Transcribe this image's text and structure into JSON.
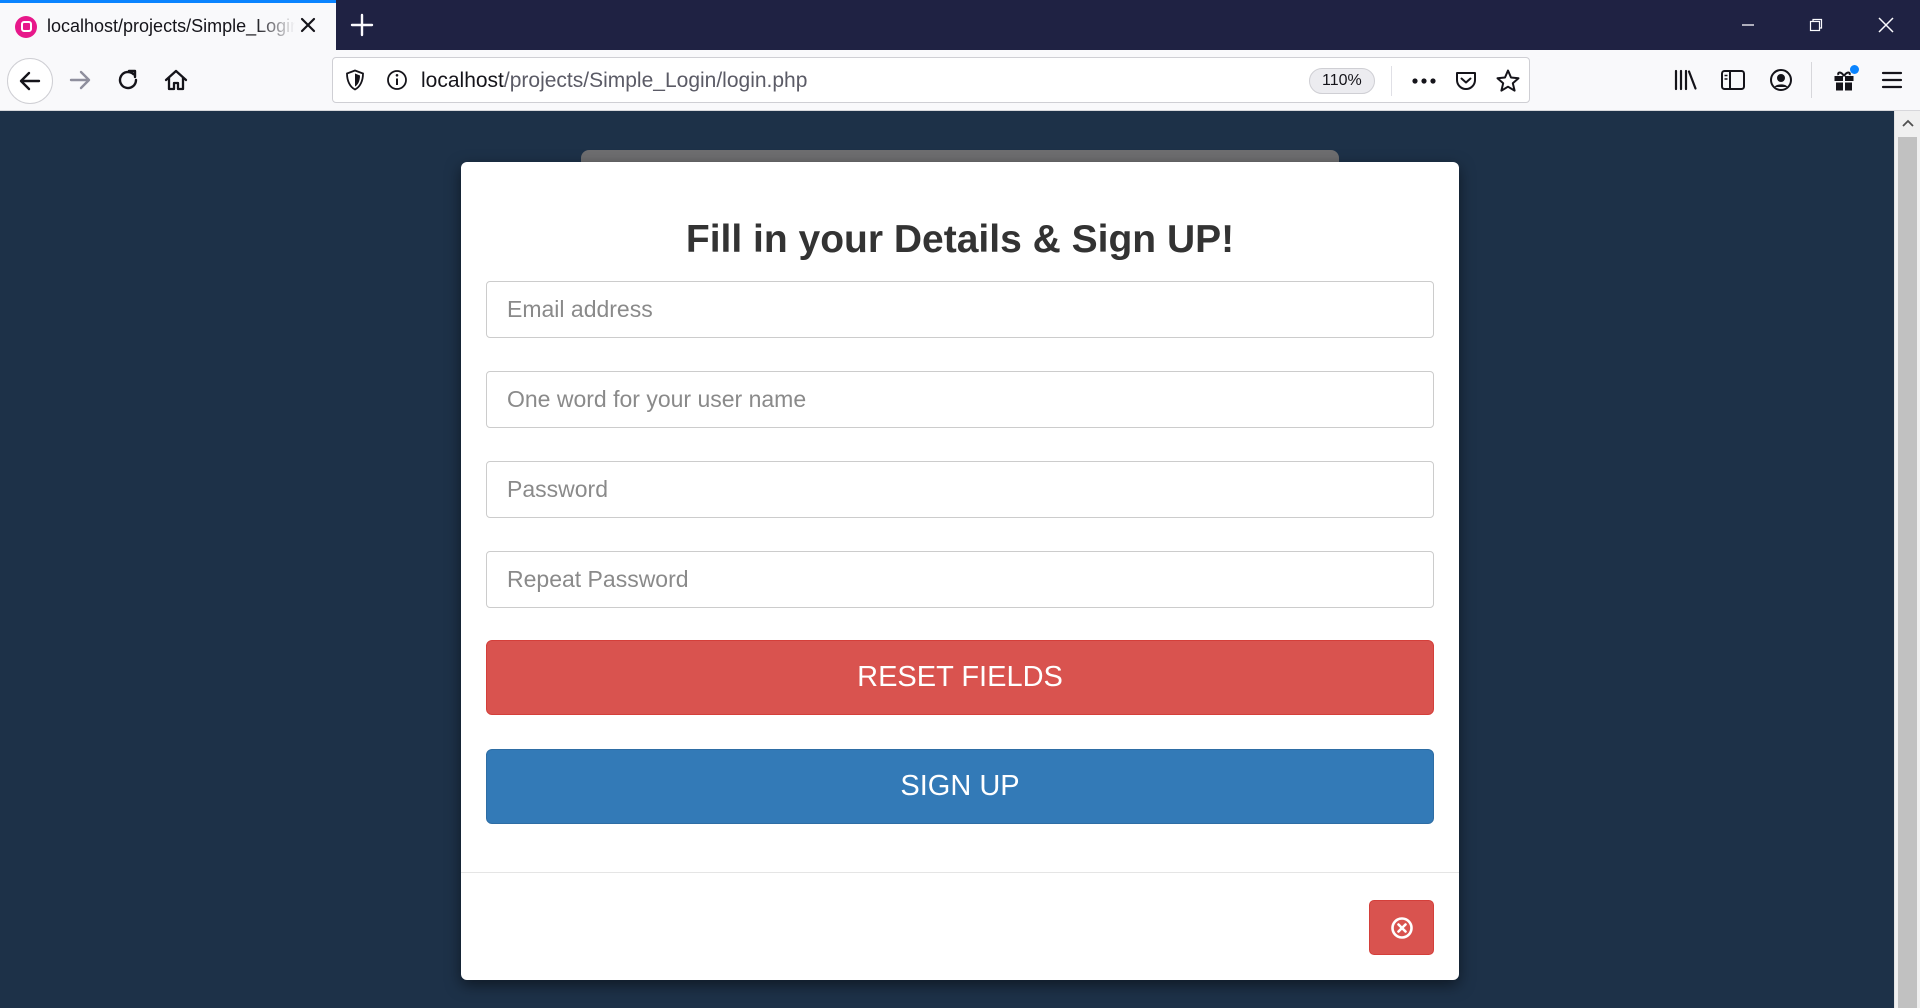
{
  "browser": {
    "tab": {
      "title": "localhost/projects/Simple_Login/login.php"
    },
    "url": {
      "host": "localhost",
      "path": "/projects/Simple_Login/login.php"
    },
    "zoom": "110%",
    "icons": {
      "favicon": "wamp-favicon",
      "tab_close": "close-icon",
      "new_tab": "plus-icon",
      "minimize": "minimize-icon",
      "restore": "restore-icon",
      "close_window": "close-icon",
      "back": "arrow-left-icon",
      "forward": "arrow-right-icon",
      "reload": "reload-icon",
      "home": "home-icon",
      "tracking": "shield-icon",
      "site_info": "info-icon",
      "page_actions": "more-icon",
      "pocket": "pocket-icon",
      "bookmark": "star-icon",
      "library": "library-icon",
      "sidebar": "sidebar-icon",
      "account": "account-icon",
      "whats_new": "gift-icon",
      "menu": "hamburger-icon"
    }
  },
  "signup_form": {
    "heading": "Fill in your Details & Sign UP!",
    "email_placeholder": "Email address",
    "username_placeholder": "One word for your user name",
    "password_placeholder": "Password",
    "repeat_password_placeholder": "Repeat Password",
    "reset_label": "RESET FIELDS",
    "signup_label": "SIGN UP",
    "close_icon": "circle-x-icon"
  },
  "colors": {
    "page_background": "#1d3148",
    "reset_button": "#d9534f",
    "signup_button": "#337ab7",
    "tab_accent": "#0a84ff"
  }
}
